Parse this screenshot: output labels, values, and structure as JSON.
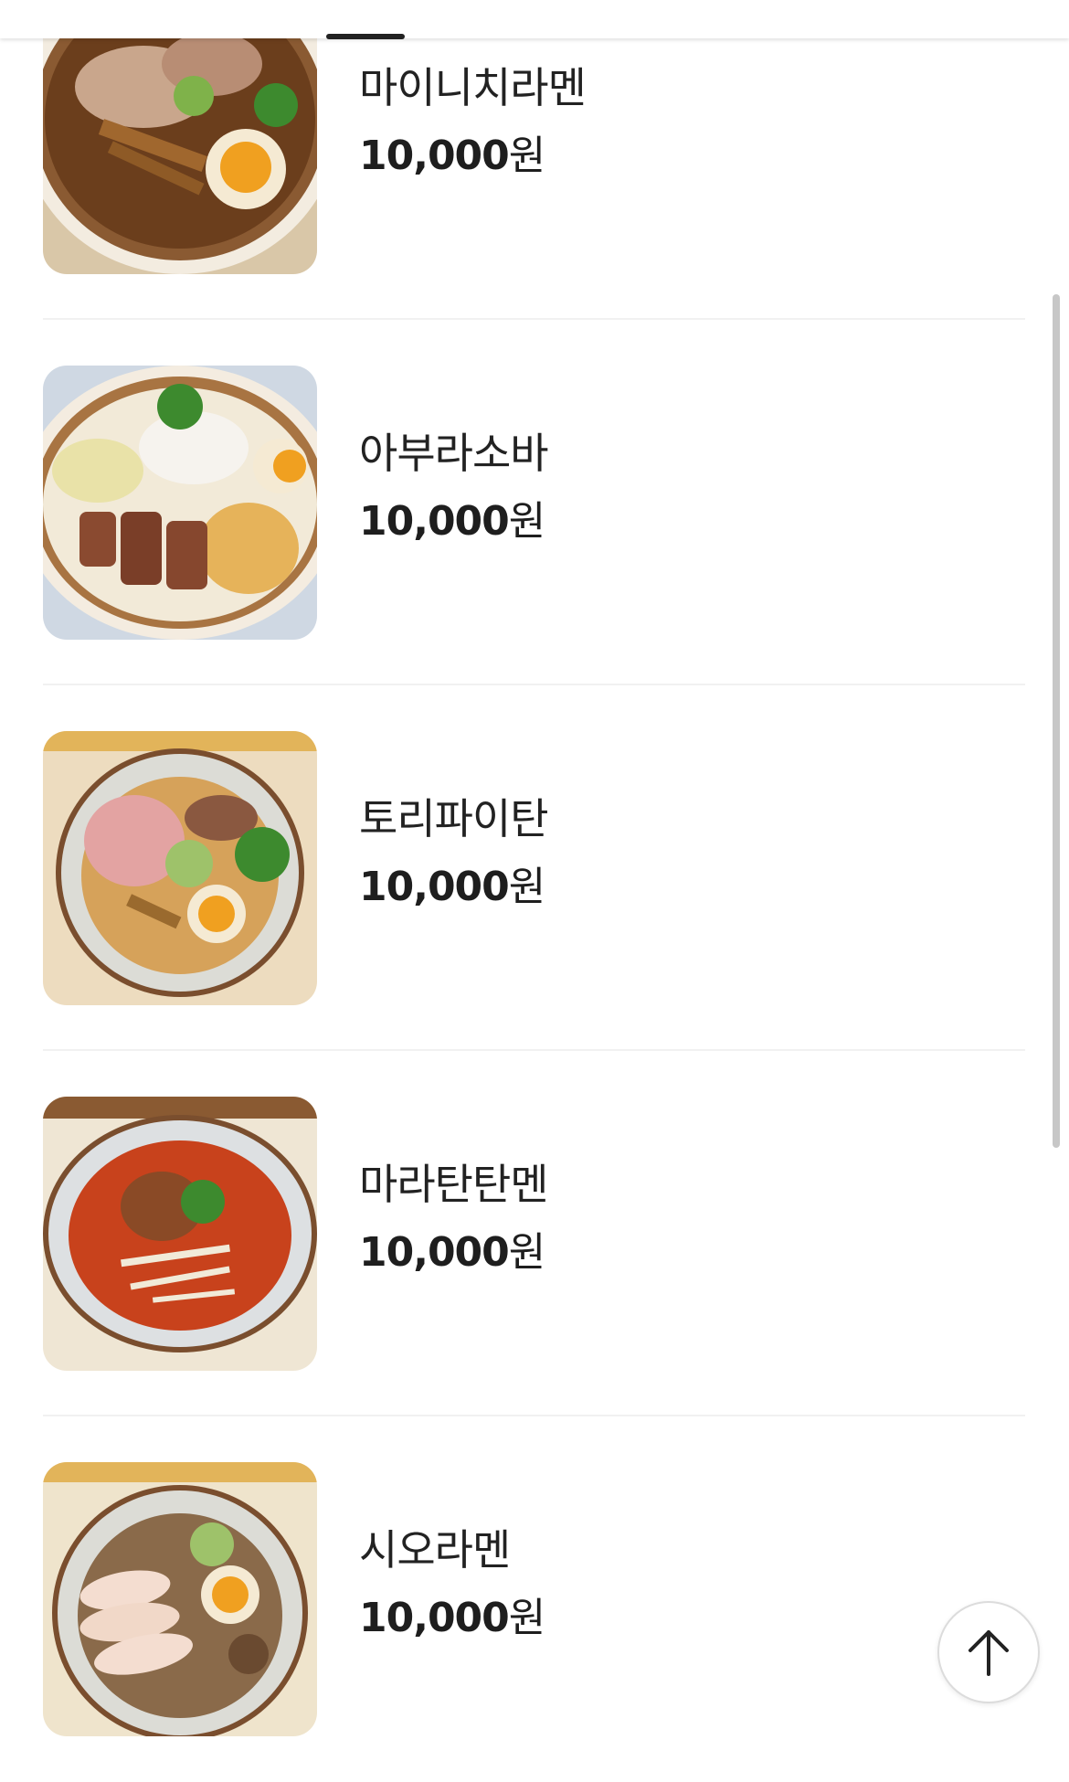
{
  "menu": {
    "items": [
      {
        "name": "마이니치라멘",
        "price": "10,000",
        "unit": "원",
        "photo": "shoyu-ramen-photo"
      },
      {
        "name": "아부라소바",
        "price": "10,000",
        "unit": "원",
        "photo": "abura-soba-photo"
      },
      {
        "name": "토리파이탄",
        "price": "10,000",
        "unit": "원",
        "photo": "tori-paitan-photo"
      },
      {
        "name": "마라탄탄멘",
        "price": "10,000",
        "unit": "원",
        "photo": "mala-tantanmen-photo"
      },
      {
        "name": "시오라멘",
        "price": "10,000",
        "unit": "원",
        "photo": "shio-ramen-photo"
      }
    ]
  },
  "icons": {
    "scroll_top": "arrow-up-icon"
  },
  "colors": {
    "text": "#222222",
    "divider": "#f1f1f1",
    "tab_indicator": "#222222"
  }
}
